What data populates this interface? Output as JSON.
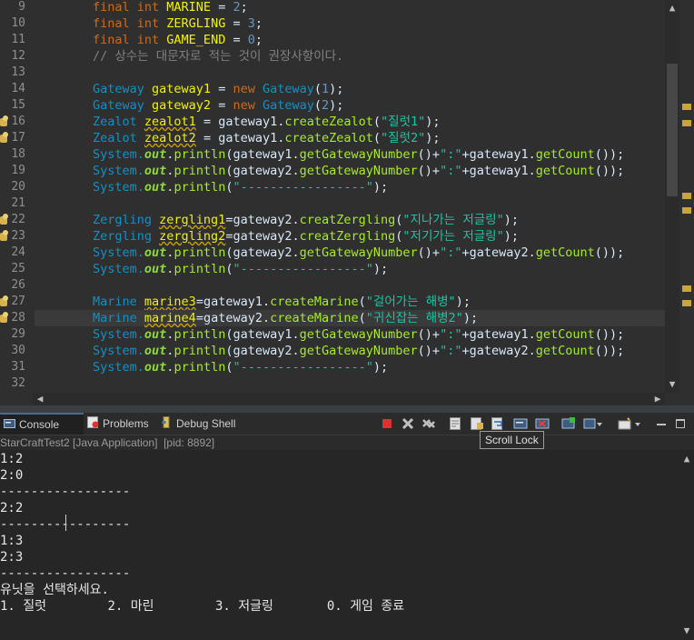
{
  "editor": {
    "lines": [
      {
        "n": "9",
        "segs": [
          [
            "kw",
            "final "
          ],
          [
            "kw",
            "int "
          ],
          [
            "var",
            "MARINE"
          ],
          [
            "p",
            " = "
          ],
          [
            "num",
            "2"
          ],
          [
            "p",
            ";"
          ]
        ]
      },
      {
        "n": "10",
        "segs": [
          [
            "kw",
            "final "
          ],
          [
            "kw",
            "int "
          ],
          [
            "var",
            "ZERGLING"
          ],
          [
            "p",
            " = "
          ],
          [
            "num",
            "3"
          ],
          [
            "p",
            ";"
          ]
        ]
      },
      {
        "n": "11",
        "segs": [
          [
            "kw",
            "final "
          ],
          [
            "kw",
            "int "
          ],
          [
            "var",
            "GAME_END"
          ],
          [
            "p",
            " = "
          ],
          [
            "num",
            "0"
          ],
          [
            "p",
            ";"
          ]
        ]
      },
      {
        "n": "12",
        "segs": [
          [
            "cmt",
            "// 상수는 대문자로 적는 것이 권장사항이다."
          ]
        ]
      },
      {
        "n": "13",
        "segs": []
      },
      {
        "n": "14",
        "segs": [
          [
            "ty",
            "Gateway "
          ],
          [
            "var",
            "gateway1"
          ],
          [
            "p",
            " = "
          ],
          [
            "kw",
            "new "
          ],
          [
            "ty",
            "Gateway"
          ],
          [
            "p",
            "("
          ],
          [
            "num",
            "1"
          ],
          [
            "p",
            ");"
          ]
        ]
      },
      {
        "n": "15",
        "segs": [
          [
            "ty",
            "Gateway "
          ],
          [
            "var",
            "gateway2"
          ],
          [
            "p",
            " = "
          ],
          [
            "kw",
            "new "
          ],
          [
            "ty",
            "Gateway"
          ],
          [
            "p",
            "("
          ],
          [
            "num",
            "2"
          ],
          [
            "p",
            ");"
          ]
        ]
      },
      {
        "n": "16",
        "m": 1,
        "segs": [
          [
            "ty",
            "Zealot "
          ],
          [
            "varu",
            "zealot1"
          ],
          [
            "p",
            " = gateway1."
          ],
          [
            "mth",
            "createZealot"
          ],
          [
            "p",
            "("
          ],
          [
            "str",
            "\"질럿1\""
          ],
          [
            "p",
            ");"
          ]
        ]
      },
      {
        "n": "17",
        "m": 1,
        "segs": [
          [
            "ty",
            "Zealot "
          ],
          [
            "varu",
            "zealot2"
          ],
          [
            "p",
            " = gateway1."
          ],
          [
            "mth",
            "createZealot"
          ],
          [
            "p",
            "("
          ],
          [
            "str",
            "\"질럿2\""
          ],
          [
            "p",
            ");"
          ]
        ]
      },
      {
        "n": "18",
        "segs": [
          [
            "ty",
            "System."
          ],
          [
            "fld",
            "out"
          ],
          [
            "p",
            "."
          ],
          [
            "mth",
            "println"
          ],
          [
            "p",
            "(gateway1."
          ],
          [
            "mth",
            "getGatewayNumber"
          ],
          [
            "p",
            "()+"
          ],
          [
            "str",
            "\":\""
          ],
          [
            "p",
            "+gateway1."
          ],
          [
            "mth",
            "getCount"
          ],
          [
            "p",
            "());"
          ]
        ]
      },
      {
        "n": "19",
        "segs": [
          [
            "ty",
            "System."
          ],
          [
            "fld",
            "out"
          ],
          [
            "p",
            "."
          ],
          [
            "mth",
            "println"
          ],
          [
            "p",
            "(gateway2."
          ],
          [
            "mth",
            "getGatewayNumber"
          ],
          [
            "p",
            "()+"
          ],
          [
            "str",
            "\":\""
          ],
          [
            "p",
            "+gateway1."
          ],
          [
            "mth",
            "getCount"
          ],
          [
            "p",
            "());"
          ]
        ]
      },
      {
        "n": "20",
        "segs": [
          [
            "ty",
            "System."
          ],
          [
            "fld",
            "out"
          ],
          [
            "p",
            "."
          ],
          [
            "mth",
            "println"
          ],
          [
            "p",
            "("
          ],
          [
            "str",
            "\"-----------------\""
          ],
          [
            "p",
            ");"
          ]
        ]
      },
      {
        "n": "21",
        "segs": []
      },
      {
        "n": "22",
        "m": 1,
        "segs": [
          [
            "ty",
            "Zergling "
          ],
          [
            "varu",
            "zergling1"
          ],
          [
            "p",
            "=gateway2."
          ],
          [
            "mth",
            "creatZergling"
          ],
          [
            "p",
            "("
          ],
          [
            "str",
            "\"지나가는 저글링\""
          ],
          [
            "p",
            ");"
          ]
        ]
      },
      {
        "n": "23",
        "m": 1,
        "segs": [
          [
            "ty",
            "Zergling "
          ],
          [
            "varu",
            "zergling2"
          ],
          [
            "p",
            "=gateway2."
          ],
          [
            "mth",
            "creatZergling"
          ],
          [
            "p",
            "("
          ],
          [
            "str",
            "\"저기가는 저글링\""
          ],
          [
            "p",
            ");"
          ]
        ]
      },
      {
        "n": "24",
        "segs": [
          [
            "ty",
            "System."
          ],
          [
            "fld",
            "out"
          ],
          [
            "p",
            "."
          ],
          [
            "mth",
            "println"
          ],
          [
            "p",
            "(gateway2."
          ],
          [
            "mth",
            "getGatewayNumber"
          ],
          [
            "p",
            "()+"
          ],
          [
            "str",
            "\":\""
          ],
          [
            "p",
            "+gateway2."
          ],
          [
            "mth",
            "getCount"
          ],
          [
            "p",
            "());"
          ]
        ]
      },
      {
        "n": "25",
        "segs": [
          [
            "ty",
            "System."
          ],
          [
            "fld",
            "out"
          ],
          [
            "p",
            "."
          ],
          [
            "mth",
            "println"
          ],
          [
            "p",
            "("
          ],
          [
            "str",
            "\"-----------------\""
          ],
          [
            "p",
            ");"
          ]
        ]
      },
      {
        "n": "26",
        "segs": []
      },
      {
        "n": "27",
        "m": 1,
        "segs": [
          [
            "ty",
            "Marine "
          ],
          [
            "varu",
            "marine3"
          ],
          [
            "p",
            "=gateway1."
          ],
          [
            "mth",
            "createMarine"
          ],
          [
            "p",
            "("
          ],
          [
            "str",
            "\"걸어가는 해병\""
          ],
          [
            "p",
            ");"
          ]
        ]
      },
      {
        "n": "28",
        "m": 1,
        "cur": 1,
        "segs": [
          [
            "ty",
            "Marine "
          ],
          [
            "varu",
            "marine4"
          ],
          [
            "p",
            "=gateway2."
          ],
          [
            "mth",
            "createMarine"
          ],
          [
            "p",
            "("
          ],
          [
            "str",
            "\"귀신잡는 해병2\""
          ],
          [
            "p",
            ");"
          ]
        ]
      },
      {
        "n": "29",
        "segs": [
          [
            "ty",
            "System."
          ],
          [
            "fld",
            "out"
          ],
          [
            "p",
            "."
          ],
          [
            "mth",
            "println"
          ],
          [
            "p",
            "(gateway1."
          ],
          [
            "mth",
            "getGatewayNumber"
          ],
          [
            "p",
            "()+"
          ],
          [
            "str",
            "\":\""
          ],
          [
            "p",
            "+gateway1."
          ],
          [
            "mth",
            "getCount"
          ],
          [
            "p",
            "());"
          ]
        ]
      },
      {
        "n": "30",
        "segs": [
          [
            "ty",
            "System."
          ],
          [
            "fld",
            "out"
          ],
          [
            "p",
            "."
          ],
          [
            "mth",
            "println"
          ],
          [
            "p",
            "(gateway2."
          ],
          [
            "mth",
            "getGatewayNumber"
          ],
          [
            "p",
            "()+"
          ],
          [
            "str",
            "\":\""
          ],
          [
            "p",
            "+gateway2."
          ],
          [
            "mth",
            "getCount"
          ],
          [
            "p",
            "());"
          ]
        ]
      },
      {
        "n": "31",
        "segs": [
          [
            "ty",
            "System."
          ],
          [
            "fld",
            "out"
          ],
          [
            "p",
            "."
          ],
          [
            "mth",
            "println"
          ],
          [
            "p",
            "("
          ],
          [
            "str",
            "\"-----------------\""
          ],
          [
            "p",
            ");"
          ]
        ]
      },
      {
        "n": "32",
        "segs": []
      }
    ]
  },
  "tabs": {
    "console": "Console",
    "problems": "Problems",
    "debug_shell": "Debug Shell"
  },
  "console_header": "StarCraftTest2 [Java Application]  [pid: 8892]",
  "tooltip": "Scroll Lock",
  "console_lines": [
    "1:2",
    "2:0",
    "-----------------",
    "2:2",
    "-----------------",
    "1:3",
    "2:3",
    "-----------------",
    "유닛을 선택하세요.",
    "1. 질럿        2. 마린        3. 저글링       0. 게임 종료"
  ],
  "colors": {
    "background": "#2f2f2f",
    "keyword": "#cc6c1d",
    "type": "#1290c3",
    "variable": "#f2f200",
    "string": "#17c6a3",
    "terminate_red": "#e03030"
  }
}
